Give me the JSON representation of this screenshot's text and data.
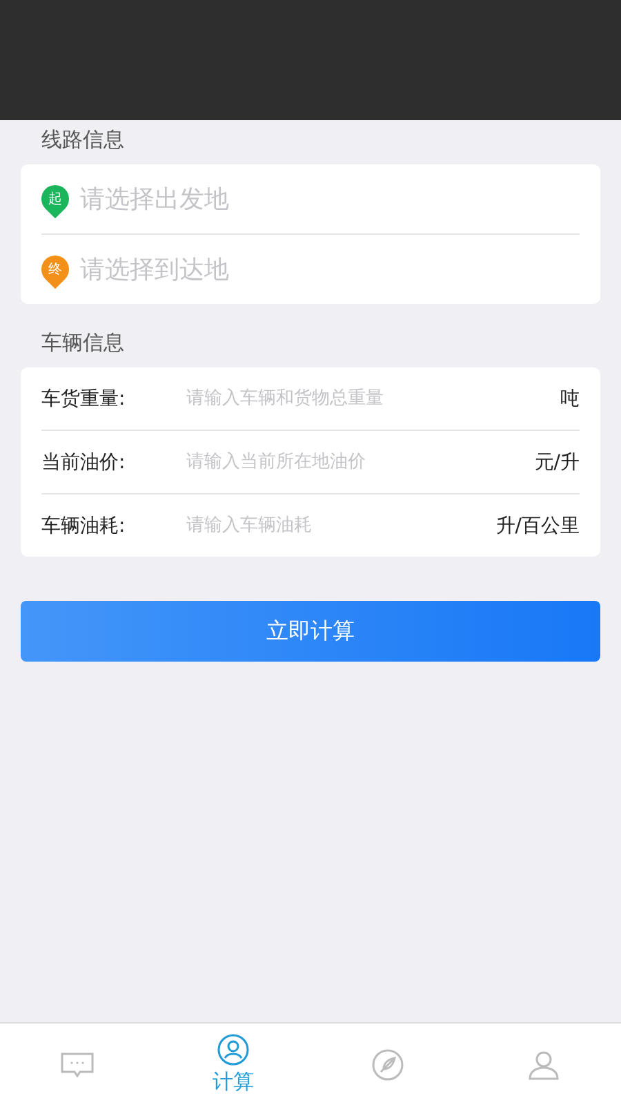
{
  "route": {
    "title": "线路信息",
    "points": [
      {
        "badge": "起",
        "placeholder": "请选择出发地",
        "color": "#1bb55c"
      },
      {
        "badge": "终",
        "placeholder": "请选择到达地",
        "color": "#f39019"
      }
    ]
  },
  "vehicle": {
    "title": "车辆信息",
    "fields": [
      {
        "label": "车货重量:",
        "placeholder": "请输入车辆和货物总重量",
        "unit": "吨"
      },
      {
        "label": "当前油价:",
        "placeholder": "请输入当前所在地油价",
        "unit": "元/升"
      },
      {
        "label": "车辆油耗:",
        "placeholder": "请输入车辆油耗",
        "unit": "升/百公里"
      }
    ]
  },
  "button": "立即计算",
  "tabs": [
    {
      "kind": "chat",
      "selected": false
    },
    {
      "kind": "profile",
      "label": "计算",
      "selected": true
    },
    {
      "kind": "compass",
      "selected": false
    },
    {
      "kind": "user",
      "selected": false
    }
  ]
}
